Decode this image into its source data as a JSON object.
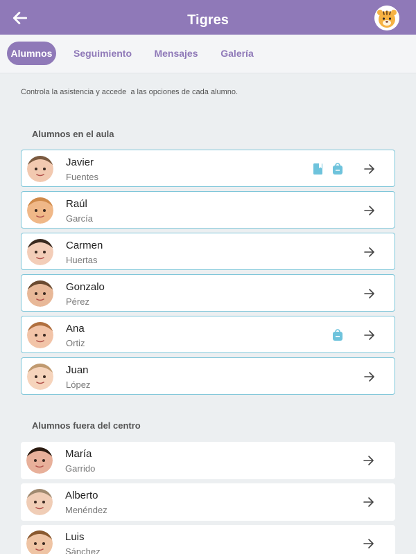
{
  "header": {
    "title": "Tigres"
  },
  "tabs": [
    {
      "label": "Alumnos"
    },
    {
      "label": "Seguimiento"
    },
    {
      "label": "Mensajes"
    },
    {
      "label": "Galería"
    }
  ],
  "intro": "Controla la asistencia y accede  a las opciones de cada alumno.",
  "sections": {
    "in_class": {
      "title": "Alumnos en el aula"
    },
    "outside": {
      "title": "Alumnos fuera del centro"
    }
  },
  "students_in": [
    {
      "first": "Javier",
      "last": "Fuentes",
      "icons": [
        "book-icon",
        "backpack-icon"
      ]
    },
    {
      "first": "Raúl",
      "last": "García",
      "icons": []
    },
    {
      "first": "Carmen",
      "last": "Huertas",
      "icons": []
    },
    {
      "first": "Gonzalo",
      "last": "Pérez",
      "icons": []
    },
    {
      "first": "Ana",
      "last": "Ortiz",
      "icons": [
        "backpack-icon"
      ]
    },
    {
      "first": "Juan",
      "last": "López",
      "icons": []
    }
  ],
  "students_out": [
    {
      "first": "María",
      "last": "Garrido"
    },
    {
      "first": "Alberto",
      "last": "Menéndez"
    },
    {
      "first": "Luis",
      "last": "Sánchez"
    }
  ],
  "colors": {
    "brand": "#8f79b8",
    "card_border": "#7ec6d9",
    "badge": "#6ec3dc",
    "background": "#eceff1"
  }
}
